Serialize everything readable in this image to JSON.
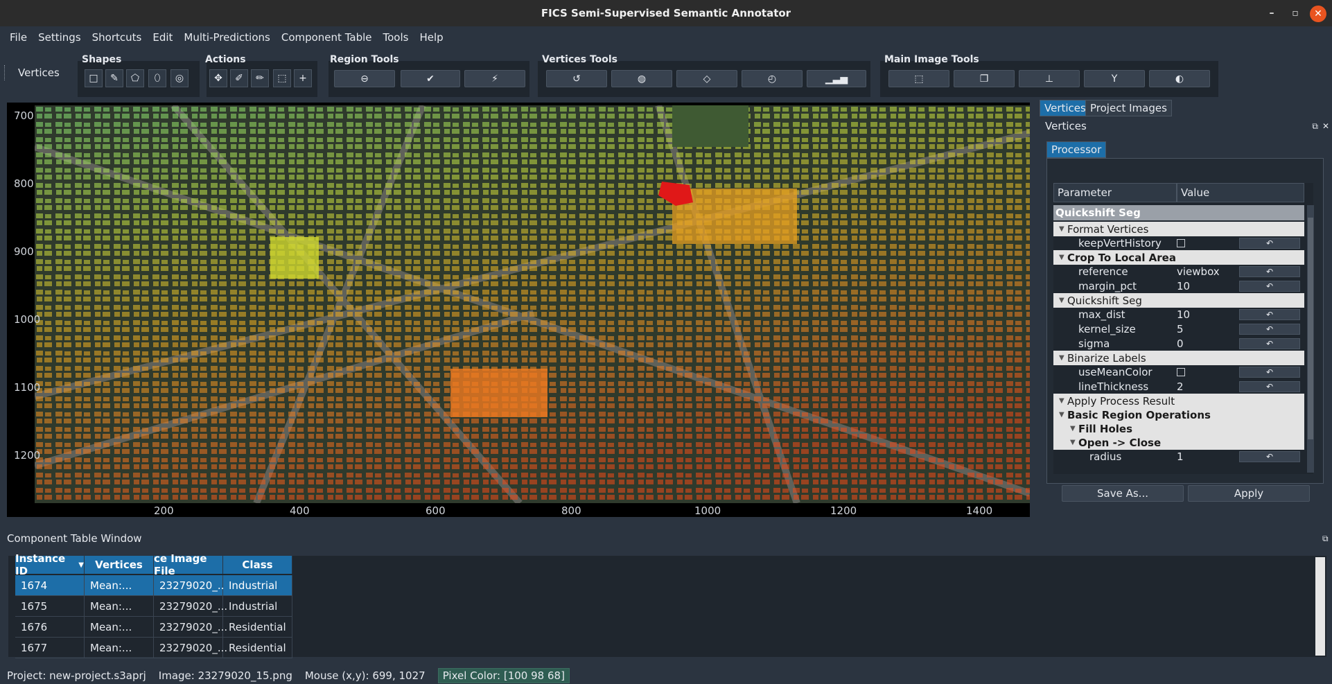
{
  "window": {
    "title": "FICS Semi-Supervised Semantic Annotator",
    "minimize_icon": "minimize-icon",
    "maximize_icon": "maximize-icon",
    "close_icon": "close-icon"
  },
  "menu": [
    "File",
    "Settings",
    "Shortcuts",
    "Edit",
    "Multi-Predictions",
    "Component Table",
    "Tools",
    "Help"
  ],
  "toolbar": {
    "dock_label": "Vertices",
    "groups": {
      "shapes": {
        "title": "Shapes",
        "icons": [
          "rectangle-icon",
          "polyline-icon",
          "polygon-icon",
          "ellipse-icon",
          "point-icon"
        ]
      },
      "actions": {
        "title": "Actions",
        "icons": [
          "move-icon",
          "edit-vertices-icon",
          "draw-icon",
          "select-icon",
          "add-icon"
        ]
      },
      "region": {
        "title": "Region Tools",
        "icons": [
          "zoom-out-icon",
          "accept-icon",
          "lightning-icon"
        ]
      },
      "vertices": {
        "title": "Vertices Tools",
        "icons": [
          "undo-icon",
          "fill-icon",
          "eraser-icon",
          "history-icon",
          "histogram-icon"
        ]
      },
      "main_image": {
        "title": "Main Image Tools",
        "icons": [
          "cursor-select-icon",
          "copy-icon",
          "stamp-icon",
          "merge-icon",
          "toggle-icon"
        ]
      }
    }
  },
  "image_view": {
    "y_ticks": [
      "700",
      "800",
      "900",
      "1000",
      "1100",
      "1200"
    ],
    "x_ticks": [
      "200",
      "400",
      "600",
      "800",
      "1000",
      "1200",
      "1400"
    ]
  },
  "right_dock": {
    "tabs": [
      "Vertices",
      "Project Images"
    ],
    "header": "Vertices",
    "processor_tab": "Processor",
    "param_headers": [
      "Parameter",
      "Value"
    ],
    "root": "Quickshift Seg",
    "rows": [
      {
        "name": "Format Vertices",
        "kind": "group",
        "indent": 1,
        "bold": false
      },
      {
        "name": "keepVertHistory",
        "kind": "check",
        "indent": 2
      },
      {
        "name": "Crop To Local Area",
        "kind": "group",
        "indent": 1,
        "bold": true
      },
      {
        "name": "reference",
        "value": "viewbox",
        "kind": "leaf",
        "indent": 2
      },
      {
        "name": "margin_pct",
        "value": "10",
        "kind": "leaf",
        "indent": 2
      },
      {
        "name": "Quickshift Seg",
        "kind": "group",
        "indent": 1,
        "bold": false
      },
      {
        "name": "max_dist",
        "value": "10",
        "kind": "leaf",
        "indent": 2
      },
      {
        "name": "kernel_size",
        "value": "5",
        "kind": "leaf",
        "indent": 2
      },
      {
        "name": "sigma",
        "value": "0",
        "kind": "leaf",
        "indent": 2
      },
      {
        "name": "Binarize Labels",
        "kind": "group",
        "indent": 1,
        "bold": false
      },
      {
        "name": "useMeanColor",
        "kind": "check",
        "indent": 2
      },
      {
        "name": "lineThickness",
        "value": "2",
        "kind": "leaf",
        "indent": 2
      },
      {
        "name": "Apply Process Result",
        "kind": "group",
        "indent": 1,
        "bold": false
      },
      {
        "name": "Basic Region Operations",
        "kind": "group",
        "indent": 1,
        "bold": true
      },
      {
        "name": "Fill Holes",
        "kind": "group",
        "indent": 2,
        "bold": true
      },
      {
        "name": "Open -> Close",
        "kind": "group",
        "indent": 2,
        "bold": true
      },
      {
        "name": "radius",
        "value": "1",
        "kind": "leaf",
        "indent": 3
      }
    ],
    "save_as_label": "Save As...",
    "apply_label": "Apply"
  },
  "component_table": {
    "title": "Component Table Window",
    "headers": [
      "Instance ID",
      "Vertices",
      "ce Image File",
      "Class"
    ],
    "rows": [
      {
        "id": "1674",
        "vertices": "Mean:...",
        "file": "23279020_...",
        "class": "Industrial"
      },
      {
        "id": "1675",
        "vertices": "Mean:...",
        "file": "23279020_...",
        "class": "Industrial"
      },
      {
        "id": "1676",
        "vertices": "Mean:...",
        "file": "23279020_...",
        "class": "Residential"
      },
      {
        "id": "1677",
        "vertices": "Mean:...",
        "file": "23279020_...",
        "class": "Residential"
      }
    ]
  },
  "status": {
    "project": "Project: new-project.s3aprj",
    "image": "Image: 23279020_15.png",
    "mouse": "Mouse (x,y): 699, 1027",
    "pixel": "Pixel Color: [100  98  68]"
  },
  "colors": {
    "accent": "#1d6ea8",
    "window_bg": "#2b3440"
  }
}
